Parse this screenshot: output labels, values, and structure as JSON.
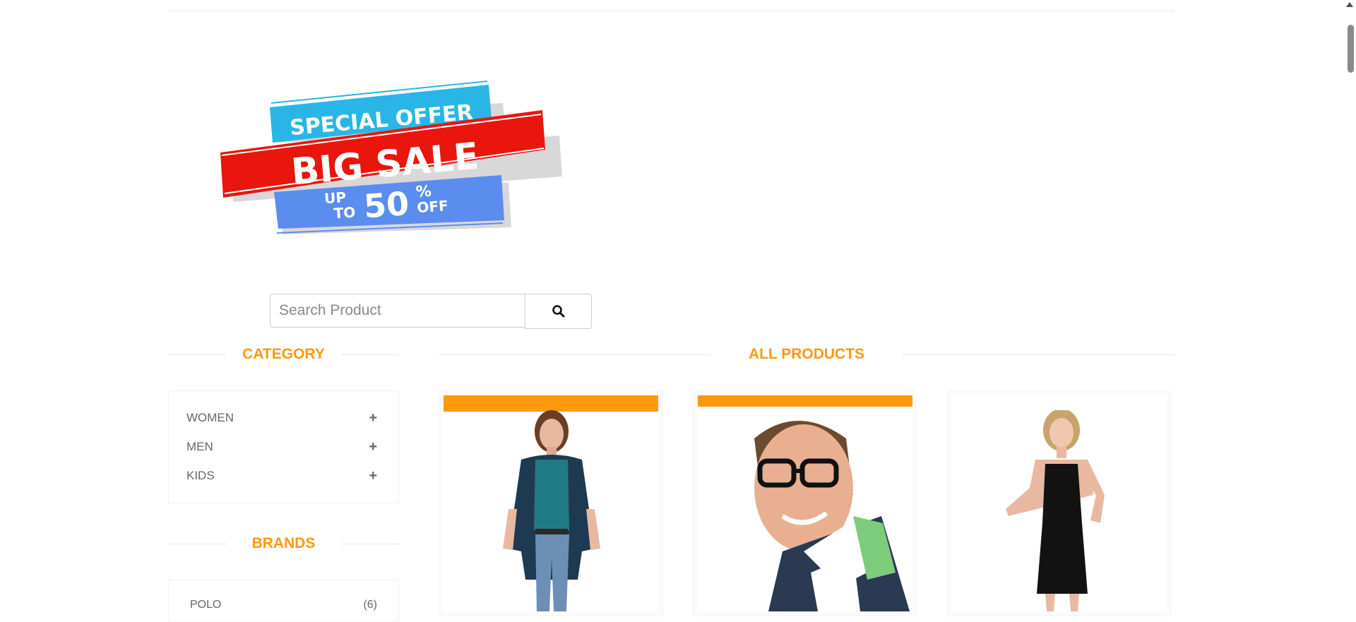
{
  "banner": {
    "line1": "SPECIAL OFFER",
    "line2": "BIG SALE",
    "line3_prefix_top": "UP",
    "line3_prefix_bottom": "TO",
    "line3_number": "50",
    "line3_percent": "%",
    "line3_suffix": "OFF",
    "colors": {
      "cyan": "#29b6e6",
      "red": "#e8160c",
      "blue": "#5b8def"
    }
  },
  "search": {
    "placeholder": "Search Product",
    "value": "",
    "button_icon": "search-icon"
  },
  "category": {
    "title": "CATEGORY",
    "items": [
      {
        "label": "WOMEN",
        "icon": "plus-icon"
      },
      {
        "label": "MEN",
        "icon": "plus-icon"
      },
      {
        "label": "KIDS",
        "icon": "plus-icon"
      }
    ]
  },
  "brands": {
    "title": "BRANDS",
    "items": [
      {
        "label": "POLO",
        "count": "(6)"
      }
    ]
  },
  "products": {
    "title": "ALL PRODUCTS",
    "items": [
      {
        "image": "woman-in-cardigan-photo",
        "tag_color": "#fe980f"
      },
      {
        "image": "man-with-glasses-photo",
        "tag_color": "#fe980f"
      },
      {
        "image": "woman-in-black-dress-photo"
      }
    ]
  },
  "theme": {
    "accent": "#fe980f",
    "text": "#696763"
  }
}
